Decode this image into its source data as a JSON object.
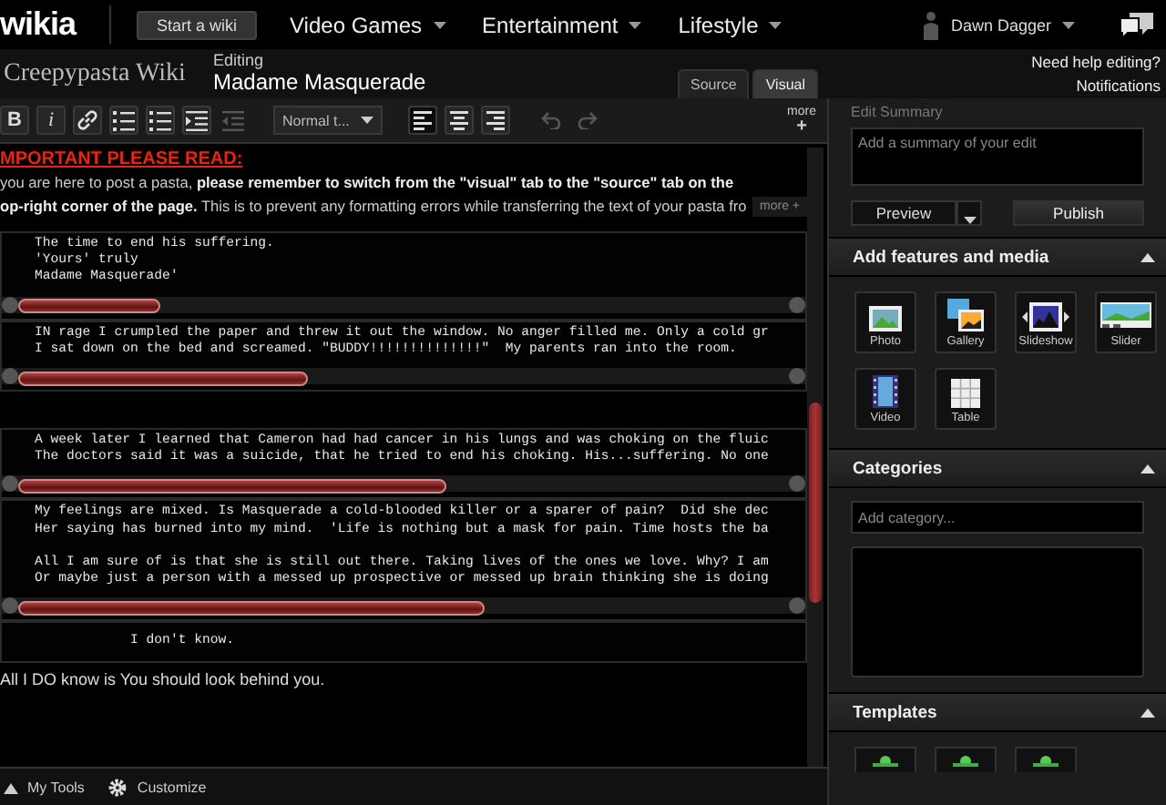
{
  "topbar": {
    "logo": "wikia",
    "start_button": "Start a wiki",
    "nav": [
      "Video Games",
      "Entertainment",
      "Lifestyle"
    ],
    "user": "Dawn Dagger"
  },
  "header": {
    "wiki_name": "Creepypasta Wiki",
    "editing_label": "Editing",
    "page_title": "Madame Masquerade",
    "tabs": [
      {
        "label": "Source",
        "selected": false
      },
      {
        "label": "Visual",
        "selected": true
      }
    ],
    "help_link": "Need help editing?",
    "notifications": "Notifications"
  },
  "toolbar": {
    "format_buttons": [
      {
        "kind": "bold",
        "label": "B",
        "disabled": false
      },
      {
        "kind": "italic",
        "label": "i",
        "disabled": false
      },
      {
        "kind": "link",
        "disabled": false
      },
      {
        "kind": "bullets",
        "disabled": false
      },
      {
        "kind": "numbers",
        "disabled": false
      },
      {
        "kind": "indent",
        "disabled": false
      },
      {
        "kind": "outdent",
        "disabled": true
      }
    ],
    "style_select": "Normal t...",
    "align_buttons": [
      {
        "kind": "left",
        "selected": true
      },
      {
        "kind": "center",
        "selected": false
      },
      {
        "kind": "right",
        "selected": false
      }
    ],
    "history_buttons": [
      {
        "kind": "undo",
        "disabled": true
      },
      {
        "kind": "redo",
        "disabled": true
      }
    ],
    "more": {
      "label": "more",
      "icon": "+"
    }
  },
  "notice": {
    "heading": "MPORTANT PLEASE READ:",
    "lines": [
      "you are here to post a pasta, **please remember to switch from the \"visual\" tab to the \"source\" tab on the**",
      "**op-right corner of the page.** This is to prevent any formatting errors while transferring the text of your pasta fro"
    ],
    "more_button": "more +"
  },
  "code_blocks": [
    {
      "paragraphs": [
        [
          "The time to end his suffering.",
          "'Yours' truly",
          "Madame Masquerade'"
        ]
      ],
      "gap_after": false
    },
    {
      "paragraphs": [
        [
          "IN rage I crumpled the paper and threw it out the window. No anger filled me. Only a cold gr",
          "I sat down on the bed and screamed. \"BUDDY!!!!!!!!!!!!!!\"  My parents ran into the room."
        ]
      ],
      "gap_after": true
    },
    {
      "paragraphs": [
        [
          "A week later I learned that Cameron had had cancer in his lungs and was choking on the fluic",
          "The doctors said it was a suicide, that he tried to end his choking. His...suffering. No one"
        ]
      ],
      "gap_after": false
    },
    {
      "paragraphs": [
        [
          "My feelings are mixed. Is Masquerade a cold-blooded killer or a sparer of pain?  Did she dec",
          "Her saying has burned into my mind.  'Life is nothing but a mask for pain. Time hosts the ba"
        ],
        [
          "All I am sure of is that she is still out there. Taking lives of the ones we love. Why? I am",
          "Or maybe just a person with a messed up prospective or messed up brain thinking she is doing"
        ]
      ],
      "gap_after": false
    }
  ],
  "closing_pre": "            I don't know.",
  "closing_line": "All I DO know is You should look behind you.",
  "footer": {
    "items": [
      {
        "kind": "tools",
        "label": "My Tools"
      },
      {
        "kind": "gear",
        "label": "Customize"
      }
    ]
  },
  "sidebar": {
    "summary_label": "Edit Summary",
    "summary_placeholder": "Add a summary of your edit",
    "preview_button": "Preview",
    "publish_button": "Publish",
    "features": {
      "title": "Add features and media",
      "expanded": true,
      "items": [
        {
          "kind": "photo",
          "label": "Photo"
        },
        {
          "kind": "gallery",
          "label": "Gallery"
        },
        {
          "kind": "slideshow",
          "label": "Slideshow"
        },
        {
          "kind": "slider",
          "label": "Slider"
        },
        {
          "kind": "video",
          "label": "Video"
        },
        {
          "kind": "table",
          "label": "Table"
        }
      ]
    },
    "categories": {
      "title": "Categories",
      "expanded": true,
      "placeholder": "Add category..."
    },
    "templates": {
      "title": "Templates",
      "expanded": true
    }
  }
}
